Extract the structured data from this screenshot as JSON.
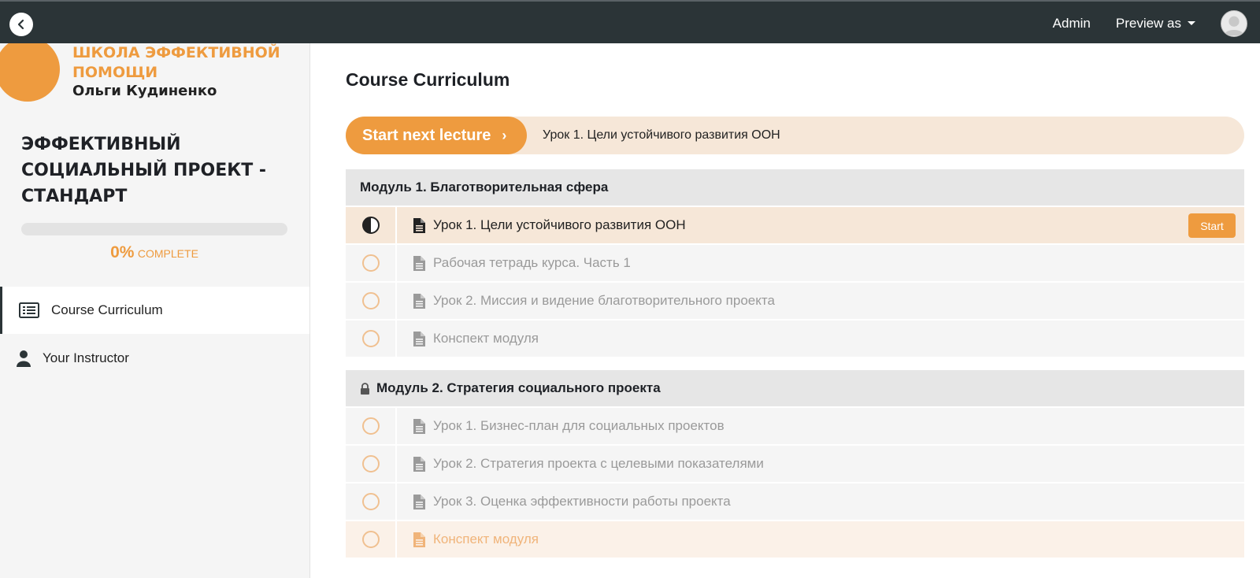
{
  "topbar": {
    "admin_label": "Admin",
    "preview_label": "Preview as"
  },
  "school": {
    "name_line": "ШКОЛА ЭФФЕКТИВНОЙ ПОМОЩИ",
    "owner_line": "Ольги Кудиненко"
  },
  "course": {
    "title": "ЭФФЕКТИВНЫЙ СОЦИАЛЬНЫЙ ПРОЕКТ - СТАНДАРТ",
    "progress_fraction": 0,
    "progress_percent": "0%",
    "progress_word": "COMPLETE"
  },
  "nav": {
    "items": [
      {
        "label": "Course Curriculum",
        "icon": "list-icon",
        "active": true
      },
      {
        "label": "Your Instructor",
        "icon": "user-icon",
        "active": false
      }
    ]
  },
  "main": {
    "title": "Course Curriculum",
    "next_button_label": "Start next lecture",
    "next_arrow": "›",
    "next_lecture": "Урок 1. Цели устойчивого развития ООН",
    "start_label": "Start"
  },
  "sections": [
    {
      "title": "Модуль 1. Благотворительная сфера",
      "locked": false,
      "lectures": [
        {
          "title": "Урок 1. Цели устойчивого развития ООН",
          "status": "in-progress"
        },
        {
          "title": "Рабочая тетрадь курса. Часть 1",
          "status": "not-started"
        },
        {
          "title": "Урок 2. Миссия и видение благотворительного проекта",
          "status": "not-started"
        },
        {
          "title": "Конспект модуля",
          "status": "not-started"
        }
      ]
    },
    {
      "title": "Модуль 2. Стратегия социального проекта",
      "locked": true,
      "lectures": [
        {
          "title": "Урок 1. Бизнес-план для социальных проектов",
          "status": "not-started"
        },
        {
          "title": "Урок 2. Стратегия проекта с целевыми показателями",
          "status": "not-started"
        },
        {
          "title": "Урок 3. Оценка эффективности работы проекта",
          "status": "not-started"
        },
        {
          "title": "Конспект модуля",
          "status": "not-started"
        }
      ]
    }
  ],
  "colors": {
    "accent": "#ee9b3f",
    "topbar": "#2b3437",
    "row_current": "#f6e7d8"
  }
}
